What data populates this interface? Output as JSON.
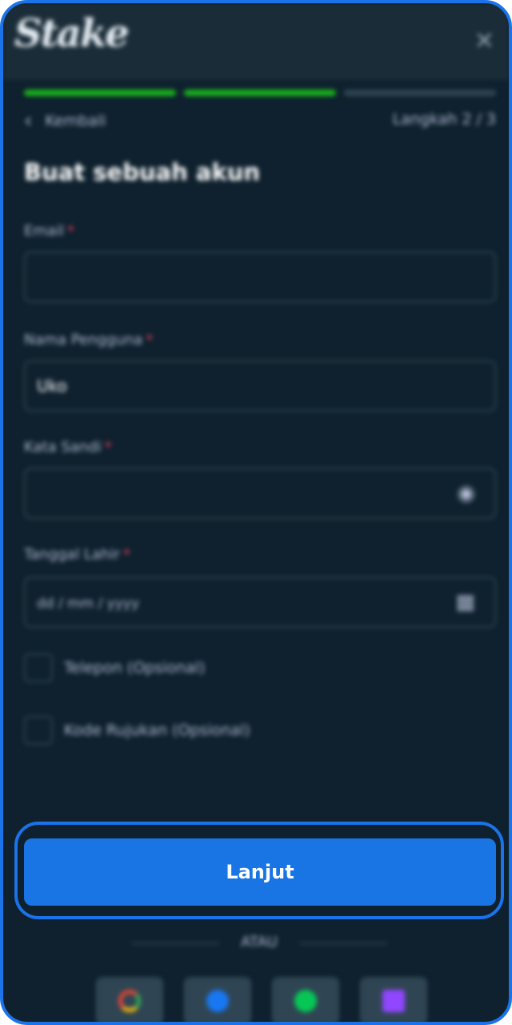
{
  "header": {
    "logo_text": "Stake",
    "close_icon": "close-icon"
  },
  "progress": {
    "steps_total": 3,
    "steps_done": 2
  },
  "nav": {
    "back_label": "Kembali",
    "step_label": "Langkah 2 / 3"
  },
  "form": {
    "title": "Buat sebuah akun",
    "email_label": "Email",
    "email_value": "",
    "username_label": "Nama Pengguna",
    "username_value": "Uko",
    "password_label": "Kata Sandi",
    "password_value": "",
    "dob_label": "Tanggal Lahir",
    "dob_placeholder": "dd / mm / yyyy",
    "phone_check_label": "Telepon (Opsional)",
    "referral_check_label": "Kode Rujukan (Opsional)",
    "required_mark": "*"
  },
  "actions": {
    "continue_label": "Lanjut",
    "or_label": "ATAU"
  },
  "social": [
    "google-icon",
    "facebook-icon",
    "line-icon",
    "twitch-icon"
  ],
  "colors": {
    "accent": "#1a73e8",
    "progress_on": "#18b31c",
    "bg": "#0f212e"
  }
}
